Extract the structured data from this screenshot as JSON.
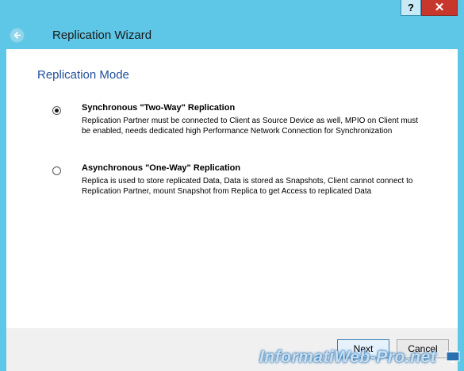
{
  "window": {
    "title": "Replication Wizard",
    "help_label": "?",
    "close_label": "✕"
  },
  "page": {
    "section_title": "Replication Mode"
  },
  "options": [
    {
      "title": "Synchronous \"Two-Way\" Replication",
      "description": "Replication Partner must be connected to Client as Source Device as well, MPIO on Client must be enabled, needs dedicated high Performance Network Connection for Synchronization",
      "selected": true
    },
    {
      "title": "Asynchronous \"One-Way\" Replication",
      "description": "Replica is used to store replicated Data, Data is stored as Snapshots, Client cannot connect to Replication Partner, mount Snapshot from Replica to get Access to replicated Data",
      "selected": false
    }
  ],
  "buttons": {
    "next_label": "Next",
    "cancel_label": "Cancel"
  },
  "watermark": {
    "text": "InformatiWeb-Pro.net"
  },
  "colors": {
    "titlebar": "#5ec6e6",
    "section_title": "#1f4e9c",
    "close_button": "#c7372b"
  }
}
